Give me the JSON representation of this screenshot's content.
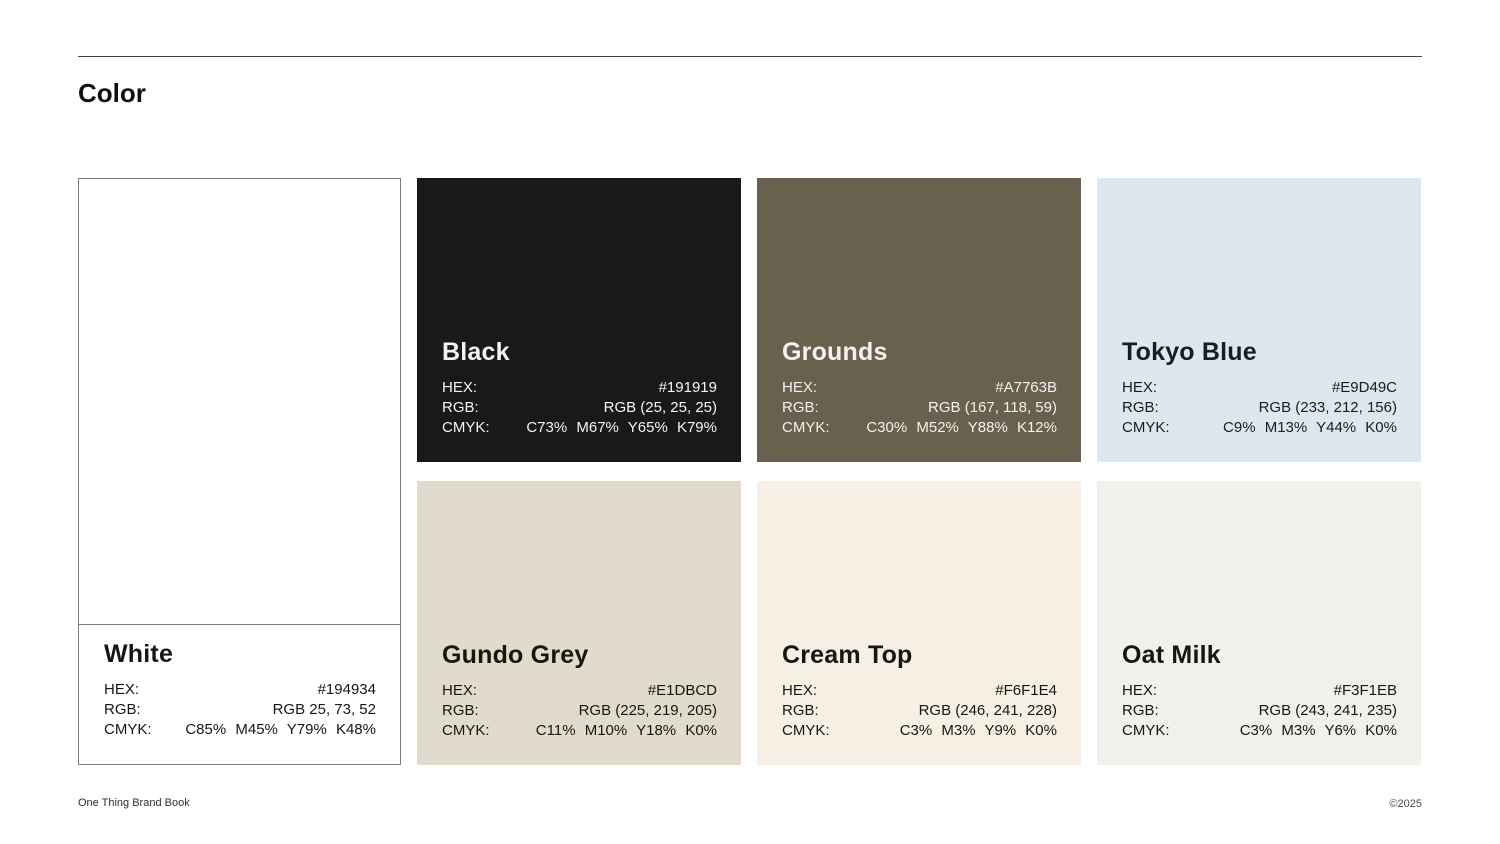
{
  "page": {
    "title": "Color",
    "footer": {
      "left": "One Thing Brand Book",
      "right": "©2025"
    },
    "background": "#ffffff",
    "rule_color": "#3f3f3f",
    "card_border_color": "#7d7d7d"
  },
  "row_labels": {
    "hex": "HEX:",
    "rgb": "RGB:",
    "cmyk": "CMYK:"
  },
  "swatches": [
    {
      "name": "White",
      "hex": "#194934",
      "rgb": "RGB 25, 73, 52",
      "cmyk": "C85%  M45%  Y79%  K48%",
      "fill": "#ffffff",
      "text_color": "#161616"
    },
    {
      "name": "Black",
      "hex": "#191919",
      "rgb": "RGB (25, 25, 25)",
      "cmyk": "C73%  M67%  Y65%  K79%",
      "fill": "#1a1919",
      "text_color": "#f4f4f4"
    },
    {
      "name": "Grounds",
      "hex": "#A7763B",
      "rgb": "RGB (167, 118, 59)",
      "cmyk": "C30%  M52%  Y88%  K12%",
      "fill": "#69604e",
      "text_color": "#f4f2ee"
    },
    {
      "name": "Tokyo Blue",
      "hex": "#E9D49C",
      "rgb": "RGB (233, 212, 156)",
      "cmyk": "C9%  M13%  Y44%  K0%",
      "fill": "#dde7f0",
      "text_color": "#191c20"
    },
    {
      "name": "Gundo Grey",
      "hex": "#E1DBCD",
      "rgb": "RGB (225, 219, 205)",
      "cmyk": "C11%  M10%  Y18%  K0%",
      "fill": "#e1dbcd",
      "text_color": "#181611"
    },
    {
      "name": "Cream Top",
      "hex": "#F6F1E4",
      "rgb": "RGB (246, 241, 228)",
      "cmyk": "C3%  M3%  Y9%  K0%",
      "fill": "#f6f0e4",
      "text_color": "#181611"
    },
    {
      "name": "Oat Milk",
      "hex": "#F3F1EB",
      "rgb": "RGB (243, 241, 235)",
      "cmyk": "C3%  M3%  Y6%  K0%",
      "fill": "#f2f0ea",
      "text_color": "#181611"
    }
  ]
}
